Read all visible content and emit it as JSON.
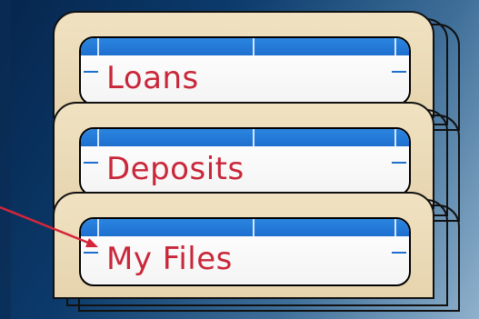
{
  "folders": [
    {
      "label": "Loans"
    },
    {
      "label": "Deposits"
    },
    {
      "label": "My Files"
    }
  ],
  "colors": {
    "label_text": "#c9273a",
    "label_band": "#1e6fcf",
    "folder": "#e6d4ae",
    "background_dark": "#06264d",
    "arrow": "#d4263a"
  },
  "annotations": {
    "pointer_target": "My Files"
  }
}
